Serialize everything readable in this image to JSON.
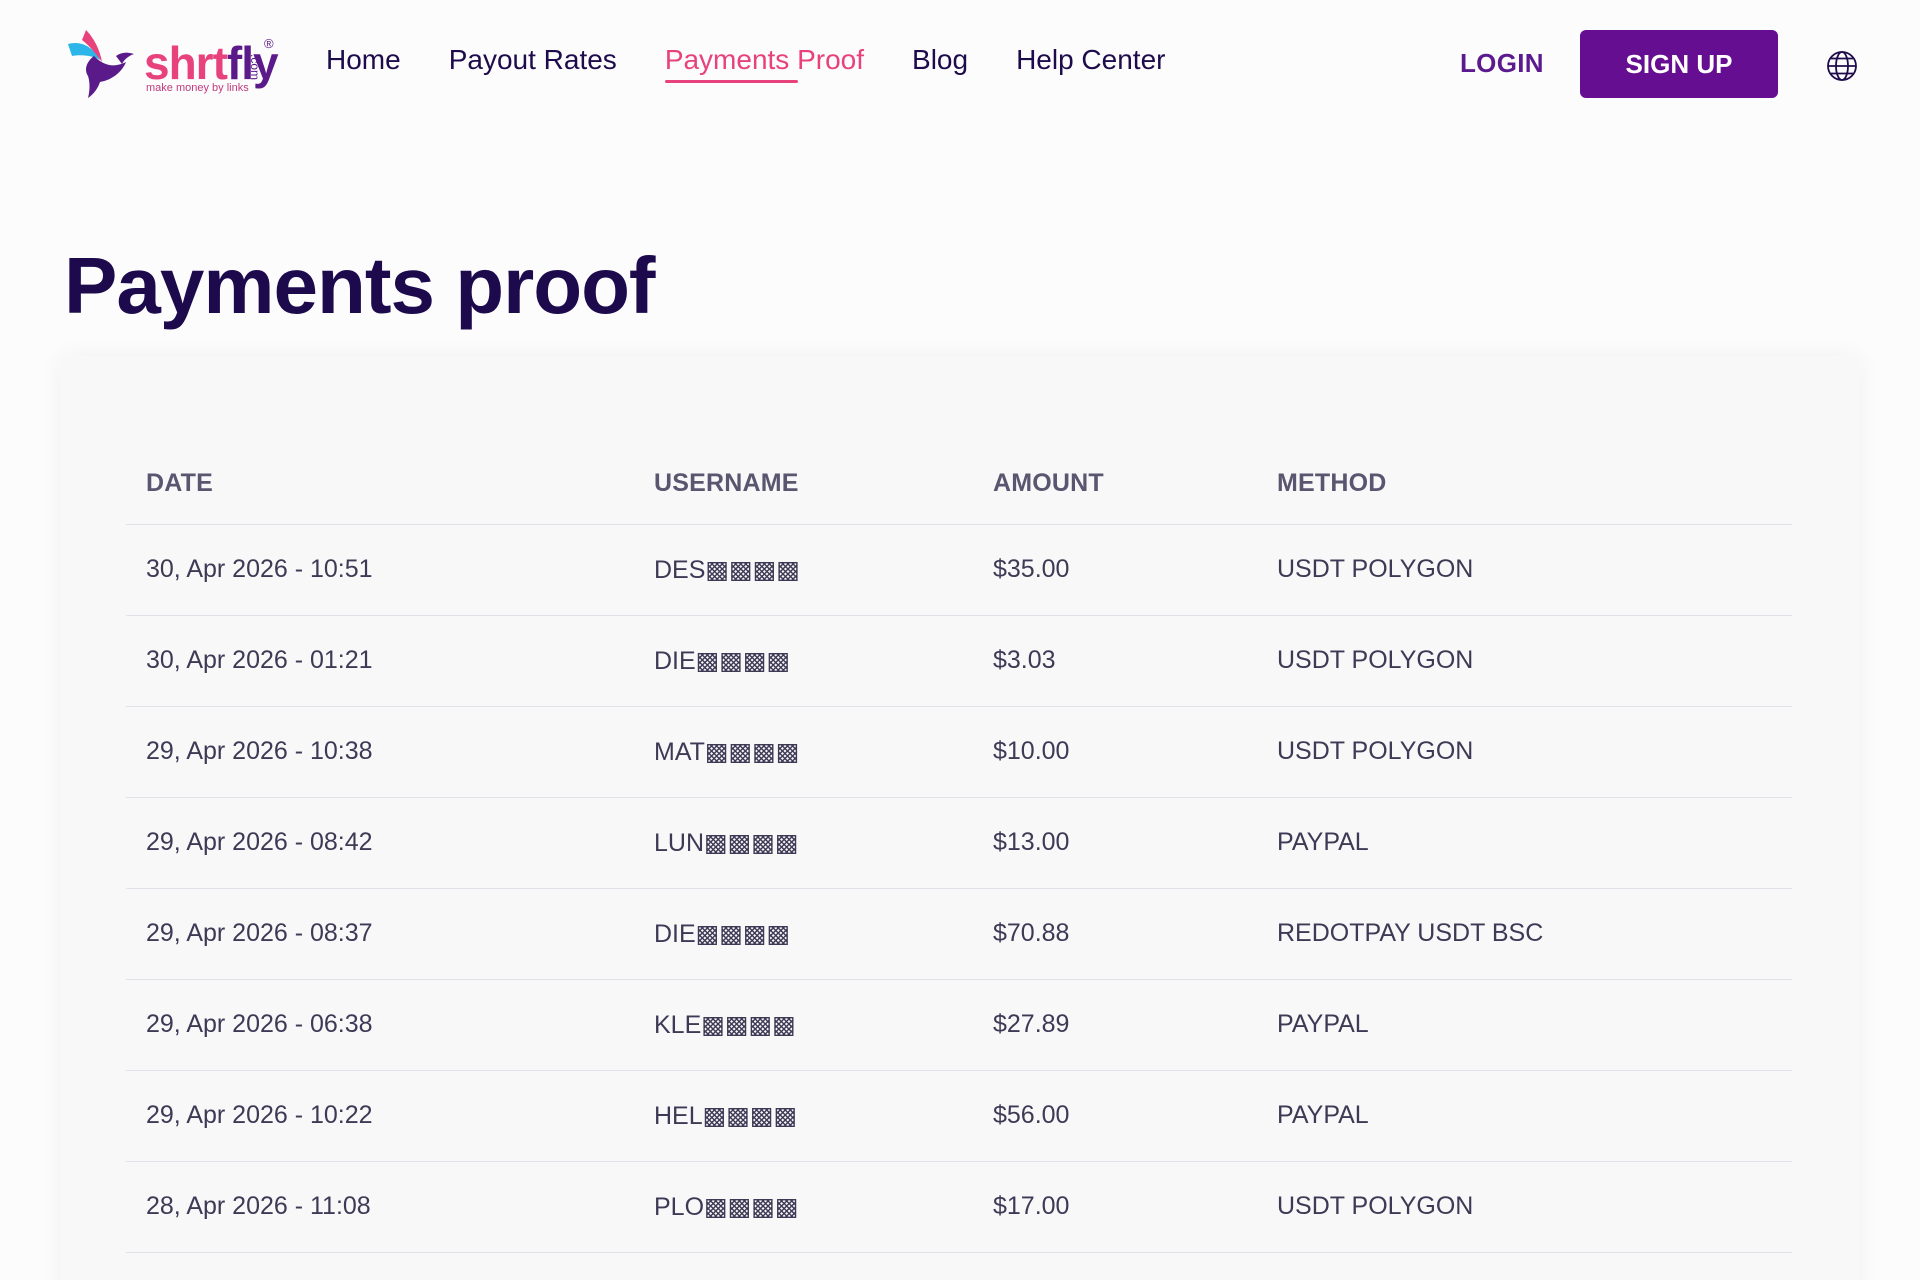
{
  "brand": {
    "logo_part1": "shrt",
    "logo_part2": "fly",
    "tagline": "make money by links",
    "suffix": ".com",
    "registered": "®"
  },
  "nav": {
    "items": [
      {
        "label": "Home",
        "active": false
      },
      {
        "label": "Payout Rates",
        "active": false
      },
      {
        "label": "Payments Proof",
        "active": true
      },
      {
        "label": "Blog",
        "active": false
      },
      {
        "label": "Help Center",
        "active": false
      }
    ],
    "login_label": "LOGIN",
    "signup_label": "SIGN UP",
    "language_icon": "globe-icon"
  },
  "page_title": "Payments proof",
  "table": {
    "headers": [
      "DATE",
      "USERNAME",
      "AMOUNT",
      "METHOD"
    ],
    "rows": [
      {
        "date": "30, Apr 2026 - 10:51",
        "username": "DES▩▩▩▩",
        "amount": "$35.00",
        "method": "USDT POLYGON"
      },
      {
        "date": "30, Apr 2026 - 01:21",
        "username": "DIE▩▩▩▩",
        "amount": "$3.03",
        "method": "USDT POLYGON"
      },
      {
        "date": "29, Apr 2026 - 10:38",
        "username": "MAT▩▩▩▩",
        "amount": "$10.00",
        "method": "USDT POLYGON"
      },
      {
        "date": "29, Apr 2026 - 08:42",
        "username": "LUN▩▩▩▩",
        "amount": "$13.00",
        "method": "PAYPAL"
      },
      {
        "date": "29, Apr 2026 - 08:37",
        "username": "DIE▩▩▩▩",
        "amount": "$70.88",
        "method": "REDOTPAY USDT BSC"
      },
      {
        "date": "29, Apr 2026 - 06:38",
        "username": "KLE▩▩▩▩",
        "amount": "$27.89",
        "method": "PAYPAL"
      },
      {
        "date": "29, Apr 2026 - 10:22",
        "username": "HEL▩▩▩▩",
        "amount": "$56.00",
        "method": "PAYPAL"
      },
      {
        "date": "28, Apr 2026 - 11:08",
        "username": "PLO▩▩▩▩",
        "amount": "$17.00",
        "method": "USDT POLYGON"
      }
    ]
  },
  "colors": {
    "accent_pink": "#e8427c",
    "brand_purple": "#660e92",
    "heading_navy": "#1d0a4c"
  }
}
